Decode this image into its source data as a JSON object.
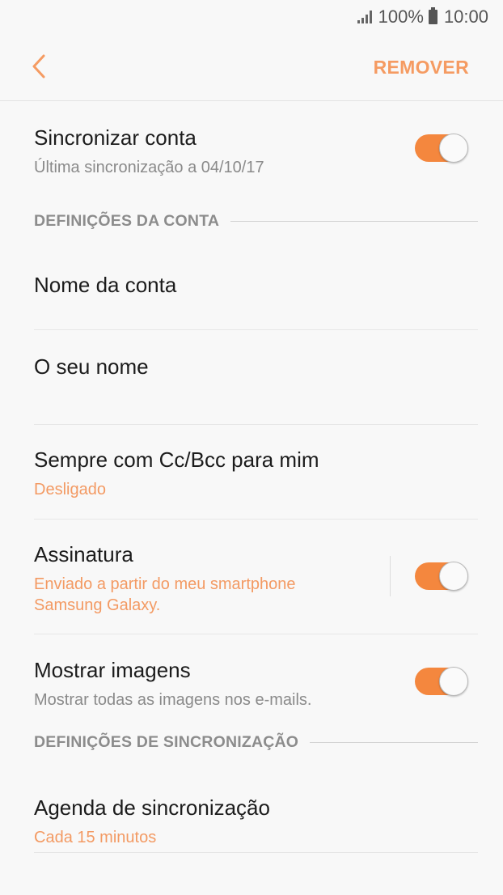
{
  "status_bar": {
    "battery": "100%",
    "time": "10:00"
  },
  "app_bar": {
    "remove_label": "REMOVER"
  },
  "sync_account": {
    "title": "Sincronizar conta",
    "subtitle": "Última sincronização a 04/10/17",
    "enabled": true
  },
  "section_account": {
    "label": "DEFINIÇÕES DA CONTA"
  },
  "account_name": {
    "title": "Nome da conta"
  },
  "your_name": {
    "title": "O seu nome"
  },
  "always_cc": {
    "title": "Sempre com Cc/Bcc para mim",
    "value": "Desligado"
  },
  "signature": {
    "title": "Assinatura",
    "value": "Enviado a partir do meu smartphone Samsung Galaxy.",
    "enabled": true
  },
  "show_images": {
    "title": "Mostrar imagens",
    "subtitle": "Mostrar todas as imagens nos e-mails.",
    "enabled": true
  },
  "section_sync": {
    "label": "DEFINIÇÕES DE SINCRONIZAÇÃO"
  },
  "sync_schedule": {
    "title": "Agenda de sincronização",
    "value": "Cada 15 minutos"
  },
  "colors": {
    "accent": "#f59b62",
    "toggle_on": "#f4873e",
    "background": "#f8f8f8"
  },
  "icons": {
    "back": "chevron-left-icon",
    "signal": "signal-icon",
    "battery": "battery-icon"
  }
}
